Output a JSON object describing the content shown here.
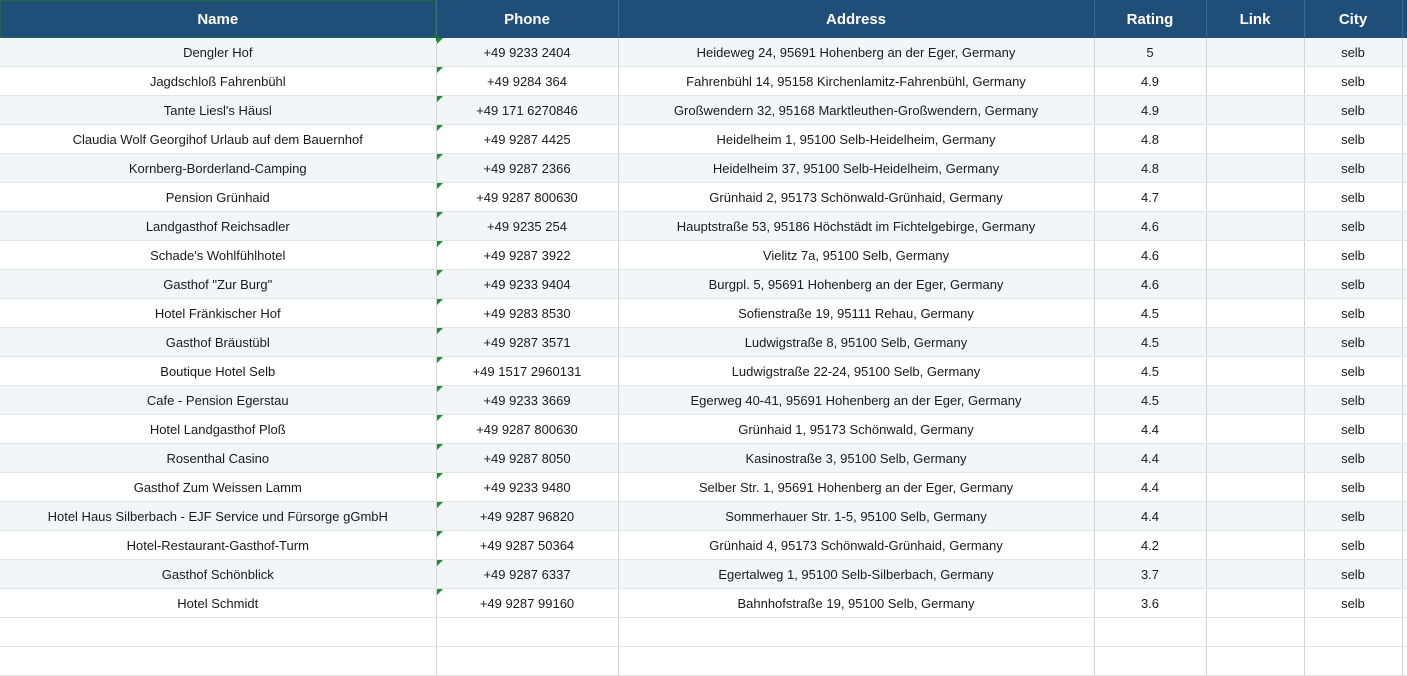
{
  "columns": {
    "name": "Name",
    "phone": "Phone",
    "address": "Address",
    "rating": "Rating",
    "link": "Link",
    "city": "City"
  },
  "rows": [
    {
      "name": "Dengler Hof",
      "phone": "+49 9233 2404",
      "address": "Heideweg 24, 95691 Hohenberg an der Eger, Germany",
      "rating": "5",
      "link": "",
      "city": "selb"
    },
    {
      "name": "Jagdschloß Fahrenbühl",
      "phone": "+49 9284 364",
      "address": "Fahrenbühl 14, 95158 Kirchenlamitz-Fahrenbühl, Germany",
      "rating": "4.9",
      "link": "",
      "city": "selb"
    },
    {
      "name": "Tante Liesl's Häusl",
      "phone": "+49 171 6270846",
      "address": "Großwendern 32, 95168 Marktleuthen-Großwendern, Germany",
      "rating": "4.9",
      "link": "",
      "city": "selb"
    },
    {
      "name": "Claudia Wolf Georgihof Urlaub auf dem Bauernhof",
      "phone": "+49 9287 4425",
      "address": "Heidelheim 1, 95100 Selb-Heidelheim, Germany",
      "rating": "4.8",
      "link": "",
      "city": "selb"
    },
    {
      "name": "Kornberg-Borderland-Camping",
      "phone": "+49 9287 2366",
      "address": "Heidelheim 37, 95100 Selb-Heidelheim, Germany",
      "rating": "4.8",
      "link": "",
      "city": "selb"
    },
    {
      "name": "Pension Grünhaid",
      "phone": "+49 9287 800630",
      "address": "Grünhaid 2, 95173 Schönwald-Grünhaid, Germany",
      "rating": "4.7",
      "link": "",
      "city": "selb"
    },
    {
      "name": "Landgasthof Reichsadler",
      "phone": "+49 9235 254",
      "address": "Hauptstraße 53, 95186 Höchstädt im Fichtelgebirge, Germany",
      "rating": "4.6",
      "link": "",
      "city": "selb"
    },
    {
      "name": "Schade's Wohlfühlhotel",
      "phone": "+49 9287 3922",
      "address": "Vielitz 7a, 95100 Selb, Germany",
      "rating": "4.6",
      "link": "",
      "city": "selb"
    },
    {
      "name": "Gasthof \"Zur Burg\"",
      "phone": "+49 9233 9404",
      "address": "Burgpl. 5, 95691 Hohenberg an der Eger, Germany",
      "rating": "4.6",
      "link": "",
      "city": "selb"
    },
    {
      "name": "Hotel Fränkischer Hof",
      "phone": "+49 9283 8530",
      "address": "Sofienstraße 19, 95111 Rehau, Germany",
      "rating": "4.5",
      "link": "",
      "city": "selb"
    },
    {
      "name": "Gasthof Bräustübl",
      "phone": "+49 9287 3571",
      "address": "Ludwigstraße 8, 95100 Selb, Germany",
      "rating": "4.5",
      "link": "",
      "city": "selb"
    },
    {
      "name": "Boutique Hotel Selb",
      "phone": "+49 1517 2960131",
      "address": "Ludwigstraße 22-24, 95100 Selb, Germany",
      "rating": "4.5",
      "link": "",
      "city": "selb"
    },
    {
      "name": "Cafe - Pension Egerstau",
      "phone": "+49 9233 3669",
      "address": "Egerweg 40-41, 95691 Hohenberg an der Eger, Germany",
      "rating": "4.5",
      "link": "",
      "city": "selb"
    },
    {
      "name": "Hotel Landgasthof Ploß",
      "phone": "+49 9287 800630",
      "address": "Grünhaid 1, 95173 Schönwald, Germany",
      "rating": "4.4",
      "link": "",
      "city": "selb"
    },
    {
      "name": "Rosenthal Casino",
      "phone": "+49 9287 8050",
      "address": "Kasinostraße 3, 95100 Selb, Germany",
      "rating": "4.4",
      "link": "",
      "city": "selb"
    },
    {
      "name": "Gasthof Zum Weissen Lamm",
      "phone": "+49 9233 9480",
      "address": "Selber Str. 1, 95691 Hohenberg an der Eger, Germany",
      "rating": "4.4",
      "link": "",
      "city": "selb"
    },
    {
      "name": "Hotel Haus Silberbach - EJF Service und Fürsorge gGmbH",
      "phone": "+49 9287 96820",
      "address": "Sommerhauer Str. 1-5, 95100 Selb, Germany",
      "rating": "4.4",
      "link": "",
      "city": "selb"
    },
    {
      "name": "Hotel-Restaurant-Gasthof-Turm",
      "phone": "+49 9287 50364",
      "address": "Grünhaid 4, 95173 Schönwald-Grünhaid, Germany",
      "rating": "4.2",
      "link": "",
      "city": "selb"
    },
    {
      "name": "Gasthof Schönblick",
      "phone": "+49 9287 6337",
      "address": "Egertalweg 1, 95100 Selb-Silberbach, Germany",
      "rating": "3.7",
      "link": "",
      "city": "selb"
    },
    {
      "name": "Hotel Schmidt",
      "phone": "+49 9287 99160",
      "address": "Bahnhofstraße 19, 95100 Selb, Germany",
      "rating": "3.6",
      "link": "",
      "city": "selb"
    }
  ],
  "empty_rows": 2,
  "colors": {
    "header_bg": "#1f4e79",
    "header_text": "#ffffff",
    "band_bg": "#f2f6f9",
    "text_indicator": "#1f8b3b"
  }
}
